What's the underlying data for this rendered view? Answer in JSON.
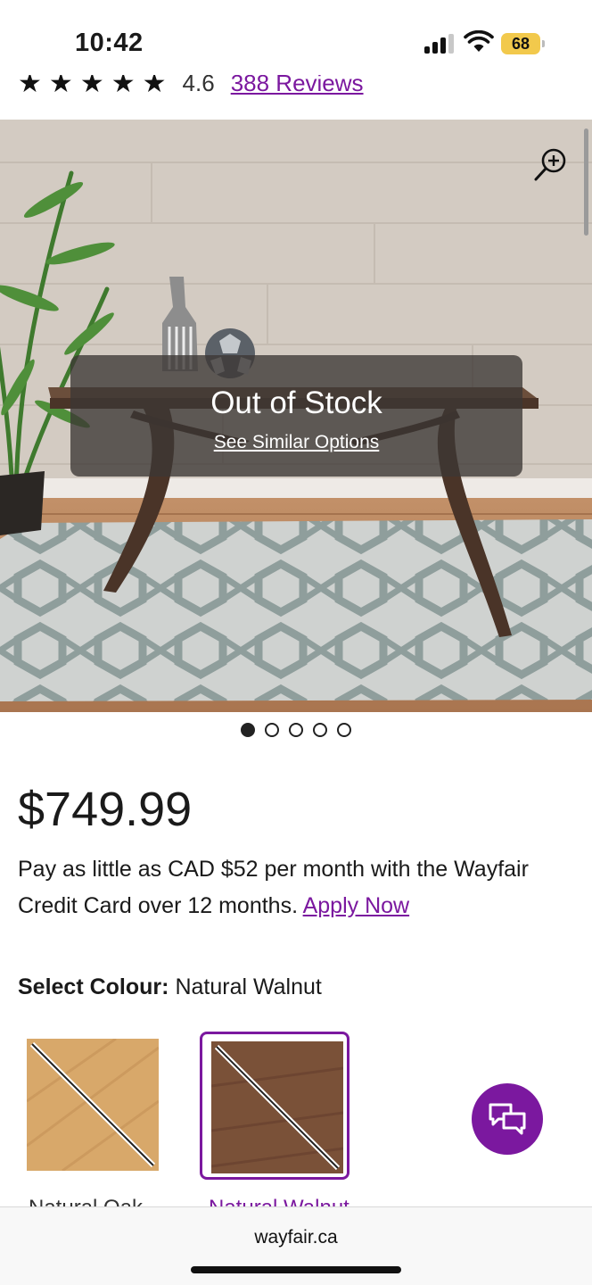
{
  "status_bar": {
    "time": "10:42",
    "battery": "68"
  },
  "rating": {
    "value": "4.6",
    "reviews_link": "388 Reviews",
    "stars": [
      "★",
      "★",
      "★",
      "★",
      "★"
    ]
  },
  "image": {
    "overlay_title": "Out of Stock",
    "overlay_link": "See Similar Options",
    "zoom_icon": "zoom-in-icon",
    "pagination": {
      "total": 5,
      "active_index": 0
    }
  },
  "product": {
    "price": "$749.99",
    "credit_text": "Pay as little as CAD $52 per month with the Wayfair Credit Card over 12 months. ",
    "credit_link": "Apply Now"
  },
  "colour": {
    "label": "Select Colour:",
    "selected": "Natural Walnut",
    "options": [
      {
        "name": "Natural Oak",
        "selected": false,
        "color": "#d8a86a"
      },
      {
        "name": "Natural Walnut",
        "selected": true,
        "color": "#7a5138"
      }
    ]
  },
  "chat": {
    "icon": "chat-icon"
  },
  "browser": {
    "url": "wayfair.ca"
  },
  "colors": {
    "accent": "#7b189f",
    "text": "#1a1a1a"
  }
}
